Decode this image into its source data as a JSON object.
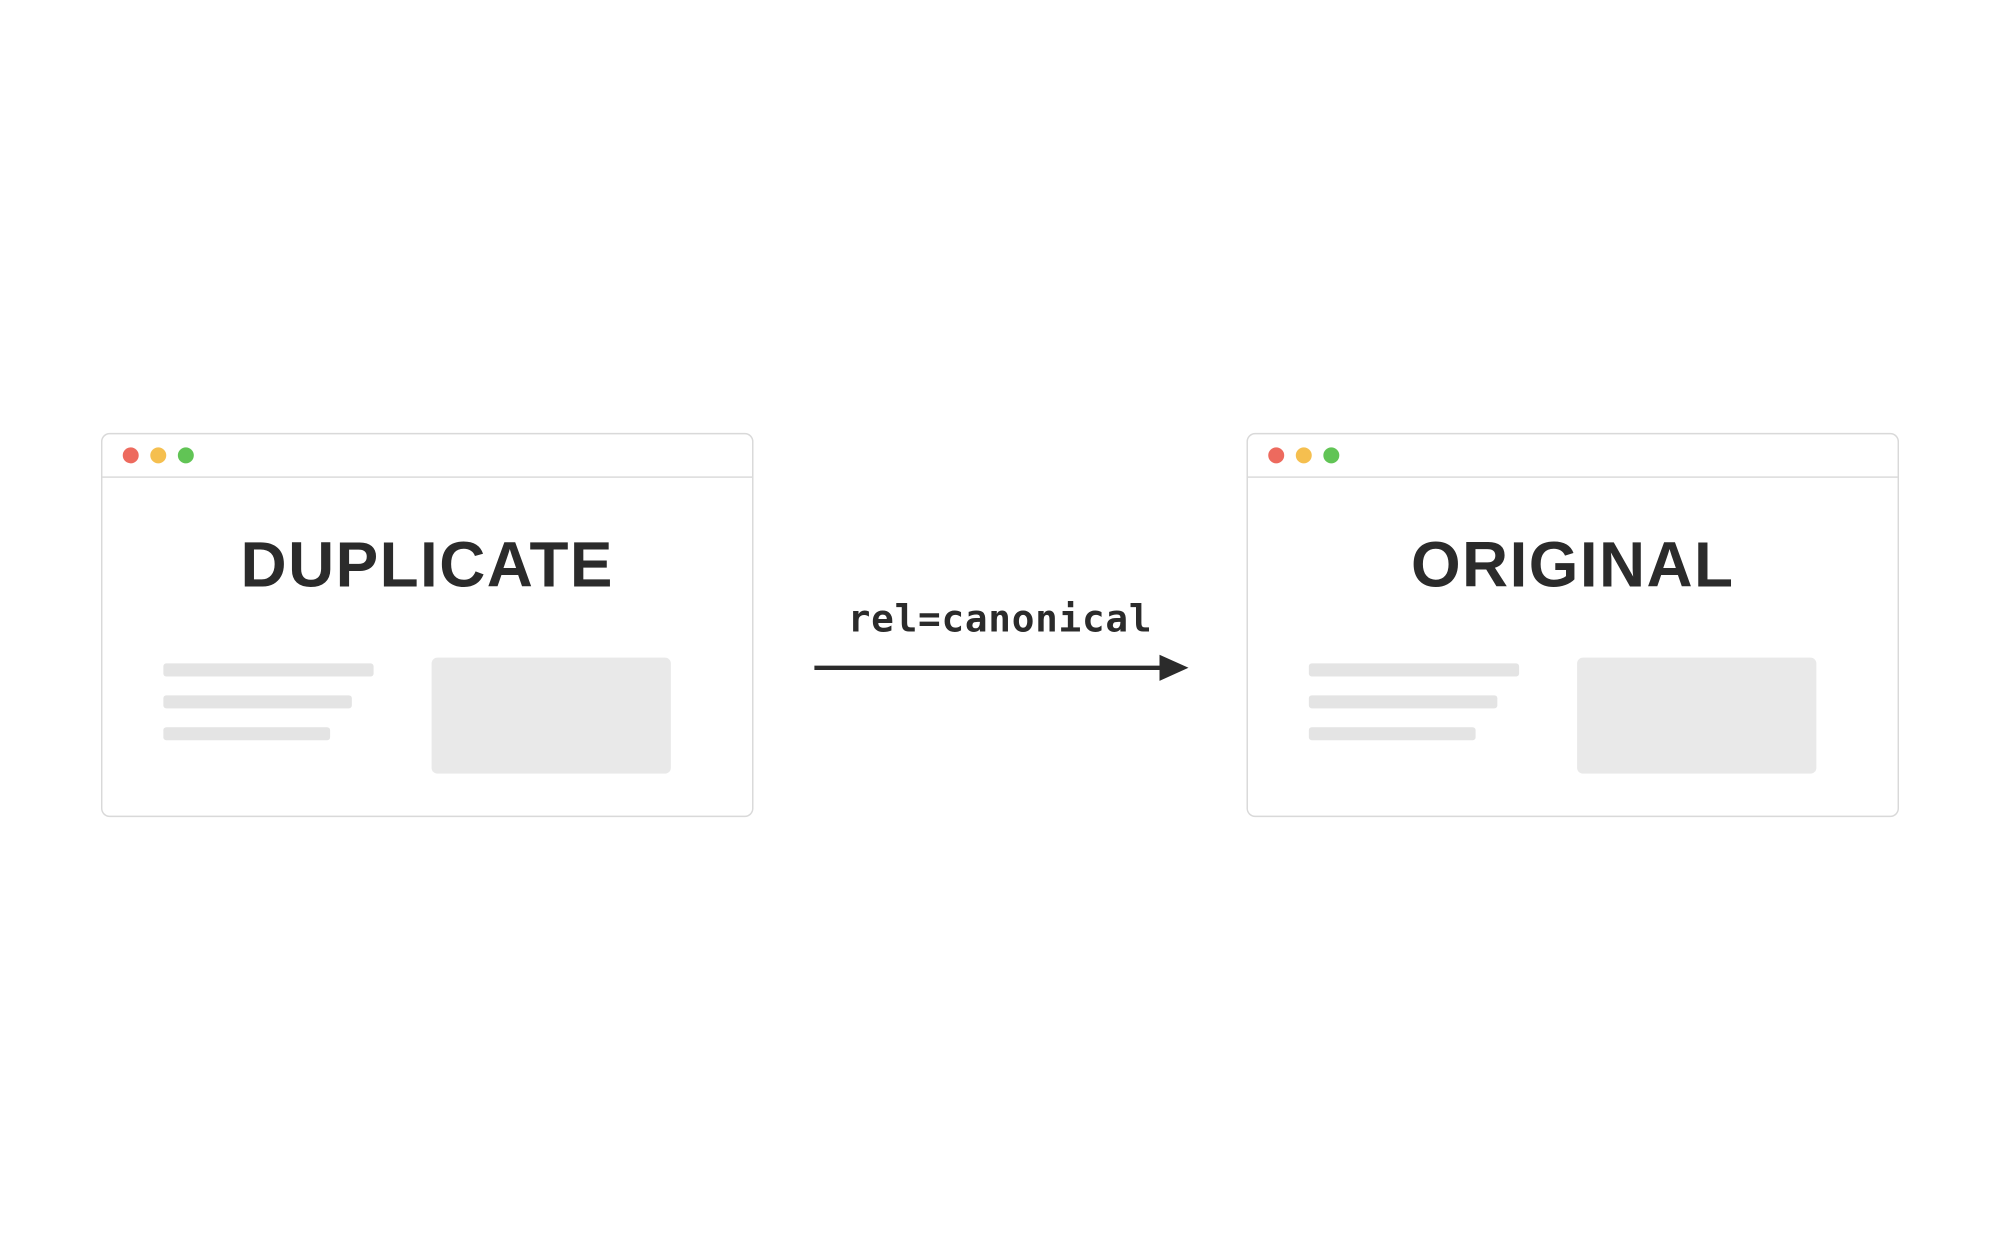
{
  "left_window": {
    "title": "DUPLICATE"
  },
  "right_window": {
    "title": "ORIGINAL"
  },
  "arrow": {
    "label": "rel=canonical"
  },
  "colors": {
    "dot_red": "#ed6a5e",
    "dot_yellow": "#f5bf4f",
    "dot_green": "#61c455",
    "border": "#d9d9d9",
    "text": "#2b2b2b",
    "placeholder": "#e4e4e4"
  }
}
